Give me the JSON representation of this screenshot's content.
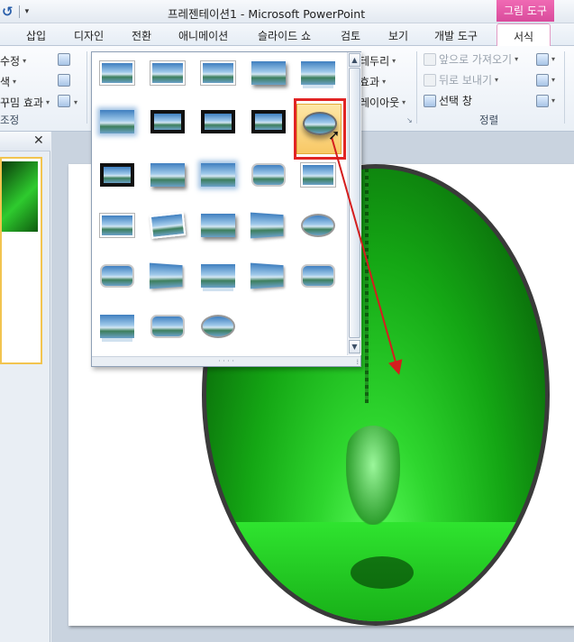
{
  "app": {
    "title": "프레젠테이션1 - Microsoft PowerPoint",
    "context_tab_group": "그림 도구"
  },
  "quick_access": {
    "undo_icon": "undo-icon",
    "dropdown": "▾"
  },
  "tabs": [
    {
      "label": "삽입"
    },
    {
      "label": "디자인"
    },
    {
      "label": "전환"
    },
    {
      "label": "애니메이션"
    },
    {
      "label": "슬라이드 쇼"
    },
    {
      "label": "검토"
    },
    {
      "label": "보기"
    },
    {
      "label": "개발 도구"
    },
    {
      "label": "서식",
      "active": true
    }
  ],
  "ribbon": {
    "adjust": {
      "items": [
        "수정",
        "색",
        "꾸밈 효과"
      ],
      "group_label": "조정"
    },
    "picture_styles_partial": {
      "items": [
        "테두리",
        "효과",
        "레이아웃"
      ]
    },
    "arrange": {
      "items": [
        "앞으로 가져오기",
        "뒤로 보내기",
        "선택 창"
      ],
      "group_label": "정렬"
    }
  },
  "gallery": {
    "styles": [
      {
        "name": "simple-frame-white"
      },
      {
        "name": "beveled-matte-white"
      },
      {
        "name": "metal-frame"
      },
      {
        "name": "drop-shadow-rectangle"
      },
      {
        "name": "reflected-rounded-rectangle"
      },
      {
        "name": "soft-edge-rectangle"
      },
      {
        "name": "double-frame-black"
      },
      {
        "name": "thick-matte-black"
      },
      {
        "name": "simple-frame-black"
      },
      {
        "name": "metal-oval",
        "selected": true
      },
      {
        "name": "compound-frame-black"
      },
      {
        "name": "center-shadow-rectangle"
      },
      {
        "name": "soft-edge-oval"
      },
      {
        "name": "snip-diagonal"
      },
      {
        "name": "moderate-frame-white"
      },
      {
        "name": "rotated-white"
      },
      {
        "name": "perspective-shadow"
      },
      {
        "name": "relaxed-perspective"
      },
      {
        "name": "bevel-perspective"
      },
      {
        "name": "soft-edge-oval-2"
      },
      {
        "name": "bevel-rectangle"
      },
      {
        "name": "bevel-perspective-left"
      },
      {
        "name": "reflected-bevel"
      },
      {
        "name": "reflected-perspective-right"
      },
      {
        "name": "metal-rounded-rectangle"
      },
      {
        "name": "reflected-bevel-white"
      },
      {
        "name": "metal-rounded"
      },
      {
        "name": "metal-oval-2"
      }
    ],
    "scroll_up": "▲",
    "scroll_down": "▼",
    "resize_grip": "⁞"
  },
  "pane": {
    "close_label": "✕"
  },
  "colors": {
    "context_tab": "#e05aa8",
    "highlight_box": "#e12424",
    "annotation_arrow": "#d41e1e",
    "slide_green": "#2ed62e"
  }
}
